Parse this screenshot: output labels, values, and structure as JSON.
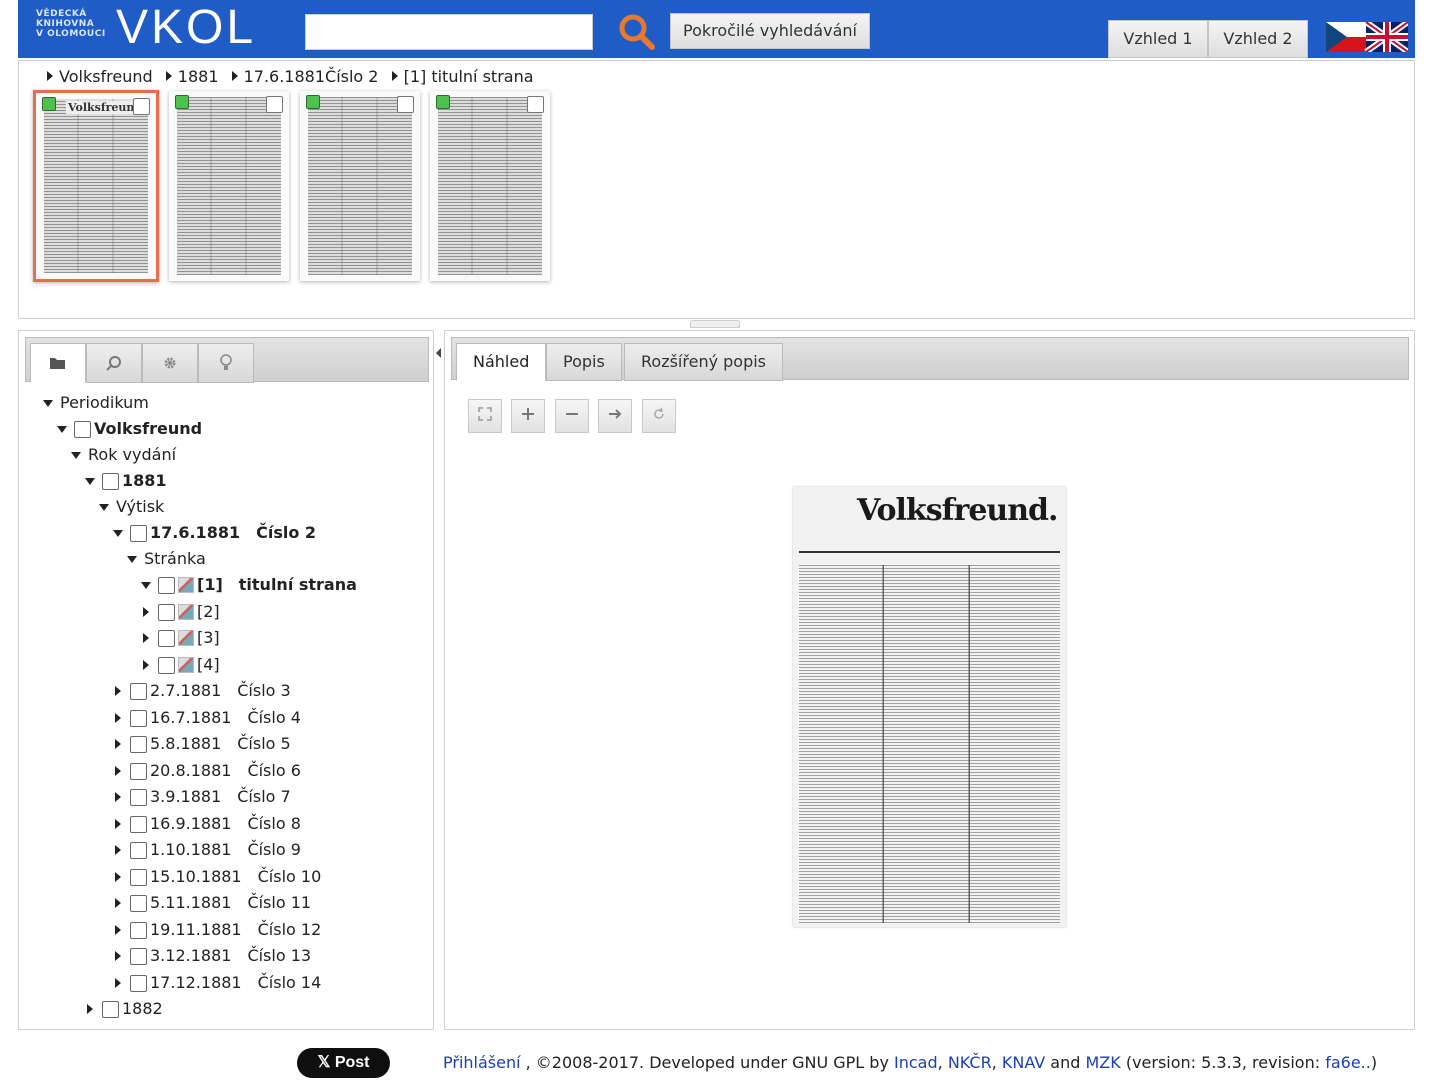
{
  "header": {
    "logo_small_lines": [
      "VĚDECKÁ",
      "KNIHOVNA",
      "V OLOMOUCI"
    ],
    "logo_big": "VKOL",
    "search": {
      "value": "",
      "placeholder": ""
    },
    "advanced_search_label": "Pokročilé vyhledávání",
    "view1_label": "Vzhled 1",
    "view2_label": "Vzhled 2",
    "language_flags": [
      "cz-flag",
      "uk-flag"
    ]
  },
  "breadcrumb": [
    "Volksfreund",
    "1881",
    "17.6.1881Číslo 2",
    "[1] titulní strana"
  ],
  "thumbnails": [
    {
      "masthead": "Volksfreund."
    },
    {
      "masthead": ""
    },
    {
      "masthead": ""
    },
    {
      "masthead": ""
    }
  ],
  "left_tabs": [
    "folder-icon",
    "search-icon",
    "gear-icon",
    "bulb-icon"
  ],
  "tree": {
    "periodikum": "Periodikum",
    "volksfreund": "Volksfreund",
    "rok_vydani": "Rok vydání",
    "year_1881": "1881",
    "vytisk": "Výtisk",
    "issue_main": {
      "date": "17.6.1881",
      "number": "Číslo 2"
    },
    "stranka": "Stránka",
    "pages": [
      {
        "label": "[1]",
        "title": "titulní strana"
      },
      {
        "label": "[2]",
        "title": ""
      },
      {
        "label": "[3]",
        "title": ""
      },
      {
        "label": "[4]",
        "title": ""
      }
    ],
    "issues": [
      {
        "date": "2.7.1881",
        "number": "Číslo 3"
      },
      {
        "date": "16.7.1881",
        "number": "Číslo 4"
      },
      {
        "date": "5.8.1881",
        "number": "Číslo 5"
      },
      {
        "date": "20.8.1881",
        "number": "Číslo 6"
      },
      {
        "date": "3.9.1881",
        "number": "Číslo 7"
      },
      {
        "date": "16.9.1881",
        "number": "Číslo 8"
      },
      {
        "date": "1.10.1881",
        "number": "Číslo 9"
      },
      {
        "date": "15.10.1881",
        "number": "Číslo 10"
      },
      {
        "date": "5.11.1881",
        "number": "Číslo 11"
      },
      {
        "date": "19.11.1881",
        "number": "Číslo 12"
      },
      {
        "date": "3.12.1881",
        "number": "Číslo 13"
      },
      {
        "date": "17.12.1881",
        "number": "Číslo 14"
      }
    ],
    "year_1882": "1882"
  },
  "right_tabs": [
    "Náhled",
    "Popis",
    "Rozšířený popis"
  ],
  "toolbar": [
    "fit-icon",
    "zoom-in-icon",
    "zoom-out-icon",
    "next-icon",
    "rotate-icon"
  ],
  "preview": {
    "masthead": "Volksfreund."
  },
  "footer": {
    "post_label": "Post",
    "login": "Přihlášení",
    "text1": " , ©2008-2017. Developed under GNU GPL by ",
    "incad": "Incad",
    "nkcr": "NKČR",
    "knav": "KNAV",
    "and": " and ",
    "mzk": "MZK",
    "version_text": " (version: 5.3.3, revision: ",
    "revision": "fa6e..",
    "close": ")"
  },
  "colors": {
    "header_bg": "#1f5cc6",
    "selected_border": "#e96d4a",
    "link": "#1a3fb5"
  }
}
